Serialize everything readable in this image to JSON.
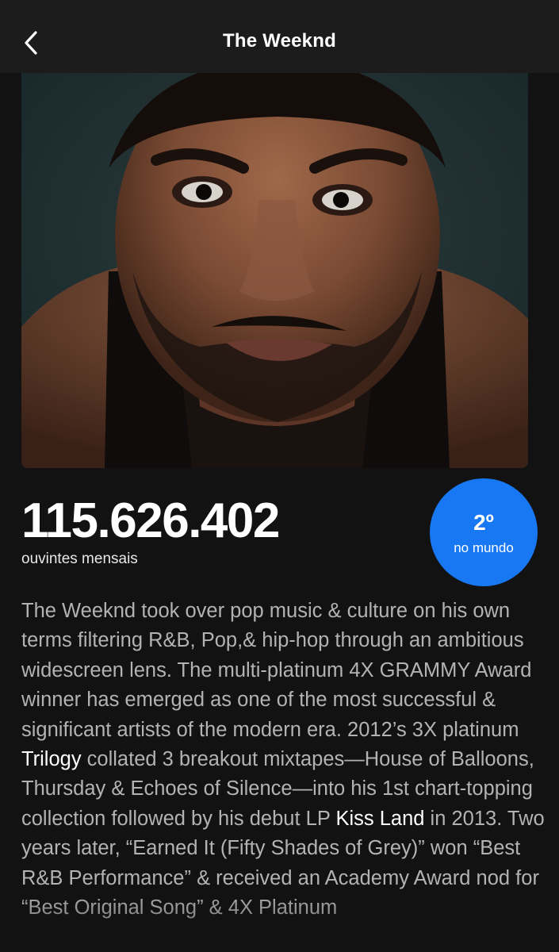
{
  "header": {
    "title": "The Weeknd",
    "back_icon": "chevron-left-icon"
  },
  "artist_photo": {
    "alt": "The Weeknd"
  },
  "stats": {
    "monthly_listeners": "115.626.402",
    "monthly_listeners_label": "ouvintes mensais",
    "rank": {
      "position": "2º",
      "scope": "no mundo",
      "color": "#1877f2"
    }
  },
  "bio": {
    "text_1": "The Weeknd took over pop music & culture on his own terms filtering R&B, Pop,& hip-hop through an ambitious widescreen lens. The multi-platinum 4X GRAMMY Award winner has emerged as one of the most successful & significant artists of the modern era. 2012’s 3X platinum ",
    "link_1": "Trilogy",
    "text_2": " collated 3 breakout mixtapes—House of Balloons, Thursday & Echoes of Silence—into his 1st chart-topping collection followed by his debut LP ",
    "link_2": "Kiss Land",
    "text_3": " in 2013. Two years later, “Earned It (Fifty Shades of Grey)” won “Best R&B Performance” & received an Academy Award nod for “Best Original Song” & 4X Platinum"
  },
  "colors": {
    "background": "#121212",
    "header_background": "#1c1c1c",
    "bio_text": "#b3b3b3",
    "link_text": "#ffffff"
  }
}
